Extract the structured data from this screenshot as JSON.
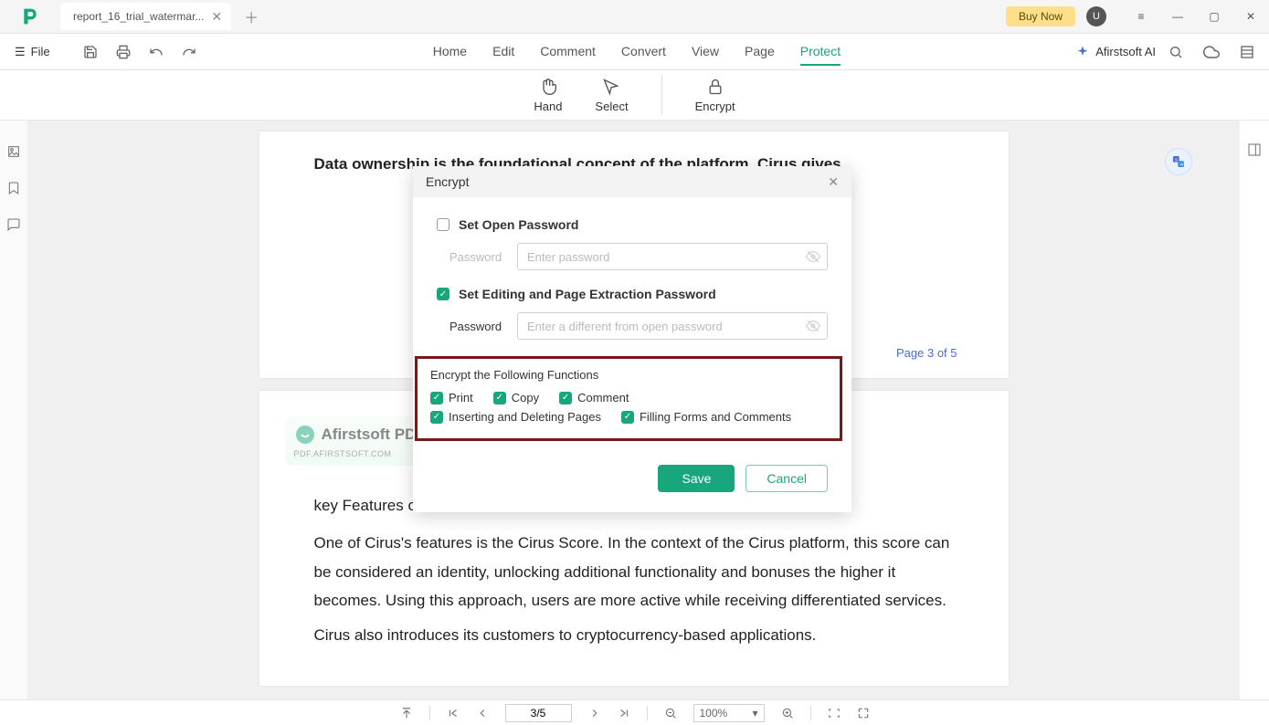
{
  "titlebar": {
    "tab_name": "report_16_trial_watermar...",
    "buy_now": "Buy Now",
    "avatar_letter": "U"
  },
  "menubar": {
    "file": "File",
    "items": [
      "Home",
      "Edit",
      "Comment",
      "Convert",
      "View",
      "Page",
      "Protect"
    ],
    "active_index": 6,
    "ai_label": "Afirstsoft AI"
  },
  "toolbar": {
    "hand": "Hand",
    "select": "Select",
    "encrypt": "Encrypt"
  },
  "document": {
    "top_line": "Data ownership is the foundational concept of the platform. Cirus gives",
    "page_indicator": "Page 3 of 5",
    "watermark_title": "Afirstsoft PDF",
    "watermark_sub": "PDF.AFIRSTSOFT.COM",
    "heading": "key Features of Cirus",
    "para1": "One of Cirus's features is the Cirus Score. In the context of the Cirus platform, this score can be considered an identity, unlocking additional functionality and bonuses the higher it becomes. Using this approach, users are more active while receiving differentiated services.",
    "para2": "Cirus also introduces its customers to cryptocurrency-based applications."
  },
  "dialog": {
    "title": "Encrypt",
    "set_open_label": "Set Open Password",
    "set_open_checked": false,
    "password_label": "Password",
    "open_placeholder": "Enter password",
    "set_edit_label": "Set Editing and Page Extraction Password",
    "set_edit_checked": true,
    "edit_placeholder": "Enter a different from open password",
    "functions_title": "Encrypt the Following Functions",
    "functions_row1": [
      {
        "label": "Print",
        "checked": true
      },
      {
        "label": "Copy",
        "checked": true
      },
      {
        "label": "Comment",
        "checked": true
      }
    ],
    "functions_row2": [
      {
        "label": "Inserting and Deleting Pages",
        "checked": true
      },
      {
        "label": "Filling Forms and Comments",
        "checked": true
      }
    ],
    "save": "Save",
    "cancel": "Cancel"
  },
  "statusbar": {
    "page_value": "3/5",
    "zoom_value": "100%"
  }
}
